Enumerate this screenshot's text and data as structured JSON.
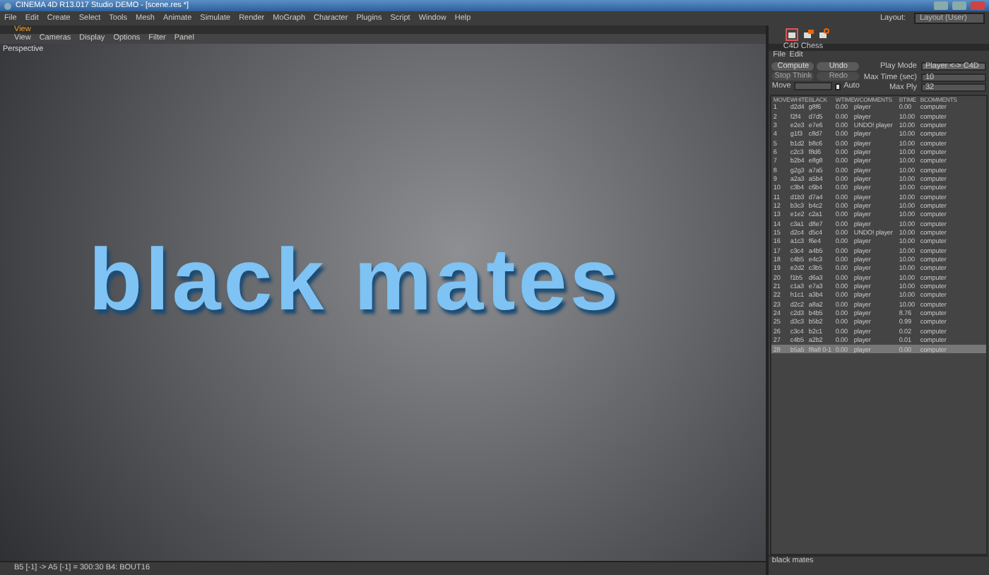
{
  "window": {
    "title": "CINEMA 4D R13.017 Studio DEMO - [scene.res *]"
  },
  "menu": [
    "File",
    "Edit",
    "Create",
    "Select",
    "Tools",
    "Mesh",
    "Animate",
    "Simulate",
    "Render",
    "MoGraph",
    "Character",
    "Plugins",
    "Script",
    "Window",
    "Help"
  ],
  "layout": {
    "label": "Layout:",
    "value": "Layout (User)"
  },
  "view_tab": {
    "label": "View",
    "selected": true
  },
  "view_menu": [
    "View",
    "Cameras",
    "Display",
    "Options",
    "Filter",
    "Panel"
  ],
  "viewport": {
    "label": "Perspective",
    "caption": "black mates"
  },
  "status_bar": "B5 [-1] -> A5 [-1] = 300:30  B4: BOUT16",
  "chess": {
    "title": "C4D Chess",
    "menu": [
      "File",
      "Edit"
    ],
    "buttons": [
      {
        "label": "Compute",
        "disabled": false
      },
      {
        "label": "Undo",
        "disabled": false
      },
      {
        "label": "Stop Think",
        "disabled": true
      },
      {
        "label": "Redo",
        "disabled": true
      }
    ],
    "play_mode": {
      "label": "Play Mode",
      "value": "Player <-> C4D"
    },
    "max_time": {
      "label": "Max Time (sec)",
      "value": "10"
    },
    "move": {
      "label": "Move"
    },
    "auto": {
      "label": "Auto",
      "checked": true
    },
    "max_ply": {
      "label": "Max Ply",
      "value": "32"
    },
    "table": {
      "columns": [
        "MOVE",
        "WHITE",
        "BLACK",
        "WTIME",
        "WCOMMENTS",
        "BTIME",
        "BCOMMENTS"
      ],
      "rows": [
        {
          "cells": [
            "1",
            "d2d4",
            "g8f6",
            "0.00",
            "player",
            "0.00",
            "computer"
          ],
          "selected": false
        },
        {
          "cells": [
            "2",
            "f2f4",
            "d7d5",
            "0.00",
            "player",
            "10.00",
            "computer"
          ],
          "selected": false
        },
        {
          "cells": [
            "3",
            "e2e3",
            "e7e6",
            "0.00",
            "UNDO! player",
            "10.00",
            "computer"
          ],
          "selected": false
        },
        {
          "cells": [
            "4",
            "g1f3",
            "c8d7",
            "0.00",
            "player",
            "10.00",
            "computer"
          ],
          "selected": false
        },
        {
          "cells": [
            "5",
            "b1d2",
            "b8c6",
            "0.00",
            "player",
            "10.00",
            "computer"
          ],
          "selected": false
        },
        {
          "cells": [
            "6",
            "c2c3",
            "f8d6",
            "0.00",
            "player",
            "10.00",
            "computer"
          ],
          "selected": false
        },
        {
          "cells": [
            "7",
            "b2b4",
            "e8g8",
            "0.00",
            "player",
            "10.00",
            "computer"
          ],
          "selected": false
        },
        {
          "cells": [
            "8",
            "g2g3",
            "a7a5",
            "0.00",
            "player",
            "10.00",
            "computer"
          ],
          "selected": false
        },
        {
          "cells": [
            "9",
            "a2a3",
            "a5b4",
            "0.00",
            "player",
            "10.00",
            "computer"
          ],
          "selected": false
        },
        {
          "cells": [
            "10",
            "c3b4",
            "c6b4",
            "0.00",
            "player",
            "10.00",
            "computer"
          ],
          "selected": false
        },
        {
          "cells": [
            "11",
            "d1b3",
            "d7a4",
            "0.00",
            "player",
            "10.00",
            "computer"
          ],
          "selected": false
        },
        {
          "cells": [
            "12",
            "b3c3",
            "b4c2",
            "0.00",
            "player",
            "10.00",
            "computer"
          ],
          "selected": false
        },
        {
          "cells": [
            "13",
            "e1e2",
            "c2a1",
            "0.00",
            "player",
            "10.00",
            "computer"
          ],
          "selected": false
        },
        {
          "cells": [
            "14",
            "c3a1",
            "d8e7",
            "0.00",
            "player",
            "10.00",
            "computer"
          ],
          "selected": false
        },
        {
          "cells": [
            "15",
            "d2c4",
            "d5c4",
            "0.00",
            "UNDO! player",
            "10.00",
            "computer"
          ],
          "selected": false
        },
        {
          "cells": [
            "16",
            "a1c3",
            "f6e4",
            "0.00",
            "player",
            "10.00",
            "computer"
          ],
          "selected": false
        },
        {
          "cells": [
            "17",
            "c3c4",
            "a4b5",
            "0.00",
            "player",
            "10.00",
            "computer"
          ],
          "selected": false
        },
        {
          "cells": [
            "18",
            "c4b5",
            "e4c3",
            "0.00",
            "player",
            "10.00",
            "computer"
          ],
          "selected": false
        },
        {
          "cells": [
            "19",
            "e2d2",
            "c3b5",
            "0.00",
            "player",
            "10.00",
            "computer"
          ],
          "selected": false
        },
        {
          "cells": [
            "20",
            "f1b5",
            "d6a3",
            "0.00",
            "player",
            "10.00",
            "computer"
          ],
          "selected": false
        },
        {
          "cells": [
            "21",
            "c1a3",
            "e7a3",
            "0.00",
            "player",
            "10.00",
            "computer"
          ],
          "selected": false
        },
        {
          "cells": [
            "22",
            "h1c1",
            "a3b4",
            "0.00",
            "player",
            "10.00",
            "computer"
          ],
          "selected": false
        },
        {
          "cells": [
            "23",
            "d2c2",
            "a8a2",
            "0.00",
            "player",
            "10.00",
            "computer"
          ],
          "selected": false
        },
        {
          "cells": [
            "24",
            "c2d3",
            "b4b5",
            "0.00",
            "player",
            "8.76",
            "computer"
          ],
          "selected": false
        },
        {
          "cells": [
            "25",
            "d3c3",
            "b5b2",
            "0.00",
            "player",
            "0.99",
            "computer"
          ],
          "selected": false
        },
        {
          "cells": [
            "26",
            "c3c4",
            "b2c1",
            "0.00",
            "player",
            "0.02",
            "computer"
          ],
          "selected": false
        },
        {
          "cells": [
            "27",
            "c4b5",
            "a2b2",
            "0.00",
            "player",
            "0.01",
            "computer"
          ],
          "selected": false
        },
        {
          "cells": [
            "28",
            "b5a5",
            "f8a8 0-1",
            "0.00",
            "player",
            "0.00",
            "computer"
          ],
          "selected": true
        }
      ]
    },
    "status": "black mates"
  }
}
